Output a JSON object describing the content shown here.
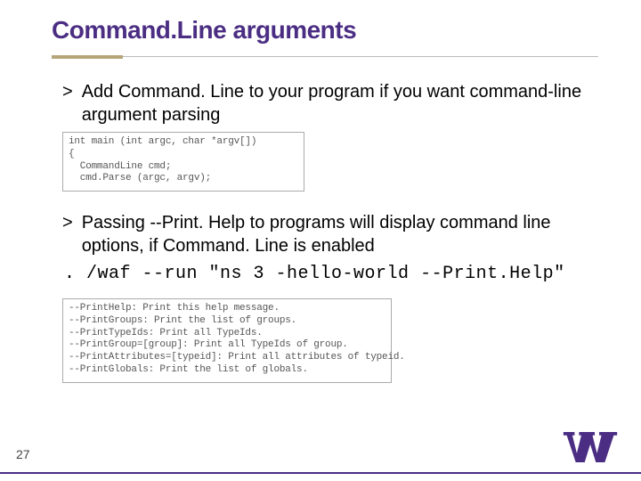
{
  "title": "Command.Line arguments",
  "bullet1": "Add Command. Line to your program if you want command-line argument parsing",
  "code1": "int main (int argc, char *argv[])\n{\n  CommandLine cmd;\n  cmd.Parse (argc, argv);",
  "bullet2": "Passing --Print. Help to programs will display command line options, if Command. Line is enabled",
  "cmdline": ". /waf --run \"ns 3 -hello-world --Print.Help\"",
  "help": "--PrintHelp: Print this help message.\n--PrintGroups: Print the list of groups.\n--PrintTypeIds: Print all TypeIds.\n--PrintGroup=[group]: Print all TypeIds of group.\n--PrintAttributes=[typeid]: Print all attributes of typeid.\n--PrintGlobals: Print the list of globals.",
  "pagenum": "27"
}
